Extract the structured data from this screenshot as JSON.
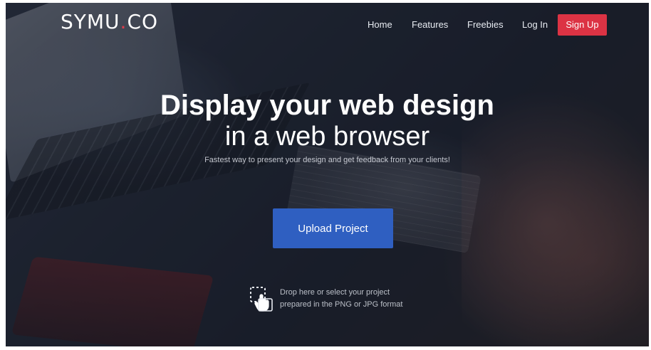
{
  "logo": {
    "part1": "SYMU",
    "dot": ".",
    "part2": "CO"
  },
  "nav": {
    "links": [
      {
        "label": "Home"
      },
      {
        "label": "Features"
      },
      {
        "label": "Freebies"
      },
      {
        "label": "Log In"
      }
    ],
    "signup_label": "Sign Up"
  },
  "hero": {
    "headline": "Display your web design",
    "subheadline": "in a web browser",
    "tagline": "Fastest way to present your design and get feedback from your clients!",
    "upload_label": "Upload Project",
    "drop_line1": "Drop here or select your project",
    "drop_line2": "prepared in the PNG or JPG format",
    "drop_icon": "drag-drop-hand-icon"
  },
  "colors": {
    "accent_red": "#dc3344",
    "primary_blue": "#2f5fc1"
  }
}
